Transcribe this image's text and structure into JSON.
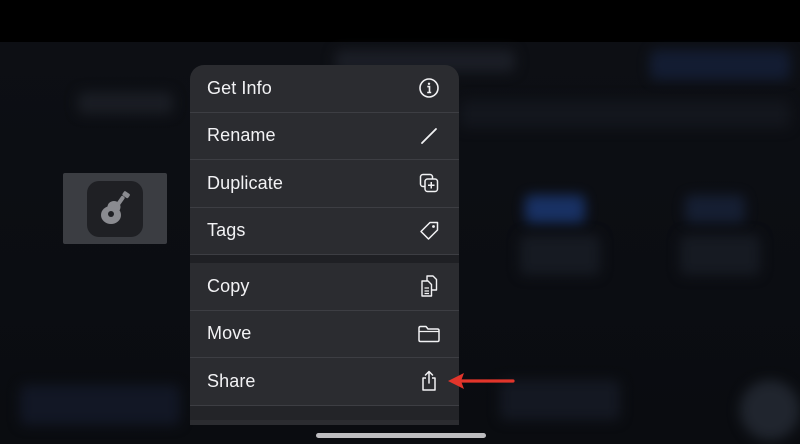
{
  "menu": {
    "items": [
      {
        "label": "Get Info",
        "icon": "info-circle-icon"
      },
      {
        "label": "Rename",
        "icon": "pencil-icon"
      },
      {
        "label": "Duplicate",
        "icon": "duplicate-plus-icon"
      },
      {
        "label": "Tags",
        "icon": "tag-icon"
      },
      {
        "label": "Copy",
        "icon": "copy-documents-icon"
      },
      {
        "label": "Move",
        "icon": "folder-icon"
      },
      {
        "label": "Share",
        "icon": "share-icon"
      }
    ]
  },
  "thumbnail": {
    "icon": "garageband-guitar-icon"
  },
  "annotation": {
    "icon": "red-arrow-left-icon",
    "color": "#e2352b"
  },
  "colors": {
    "menu_bg": "#2b2c30",
    "menu_text": "#f2f2f4",
    "separator": "#1f2024"
  }
}
